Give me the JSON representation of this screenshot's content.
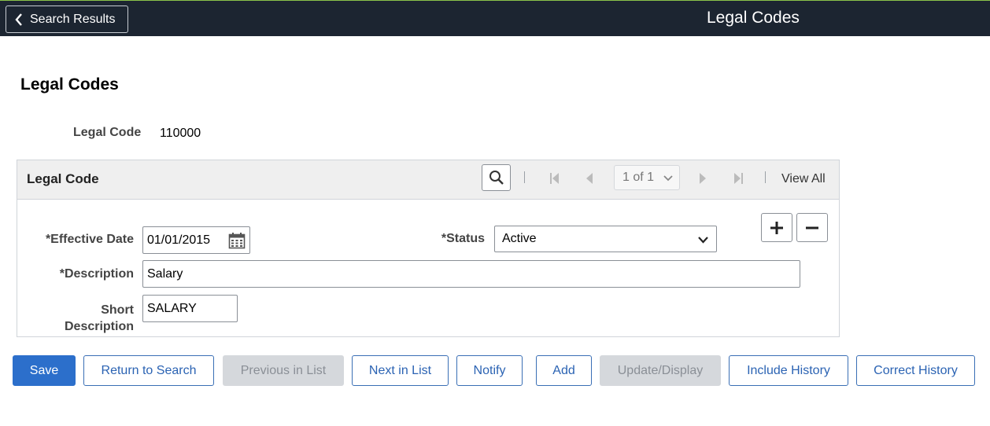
{
  "topbar": {
    "back_label": "Search Results",
    "app_title": "Legal Codes"
  },
  "page": {
    "title": "Legal Codes",
    "legal_code_label": "Legal Code",
    "legal_code_value": "110000"
  },
  "grid": {
    "title": "Legal Code",
    "page_indicator": "1 of 1",
    "view_all": "View All",
    "fields": {
      "effective_date_label": "*Effective Date",
      "effective_date_value": "01/01/2015",
      "status_label": "*Status",
      "status_value": "Active",
      "description_label": "*Description",
      "description_value": "Salary",
      "short_description_label_line1": "Short",
      "short_description_label_line2": "Description",
      "short_description_value": "SALARY"
    }
  },
  "buttons": {
    "save": "Save",
    "return_to_search": "Return to Search",
    "previous_in_list": "Previous in List",
    "next_in_list": "Next in List",
    "notify": "Notify",
    "add": "Add",
    "update_display": "Update/Display",
    "include_history": "Include History",
    "correct_history": "Correct History"
  },
  "icons": [
    "chevron-left-icon",
    "search-icon",
    "first-page-icon",
    "previous-page-icon",
    "chevron-down-icon",
    "next-page-icon",
    "last-page-icon",
    "calendar-icon",
    "plus-icon",
    "minus-icon"
  ],
  "colors": {
    "topbar_bg": "#1c2531",
    "primary": "#2c6fcb",
    "link": "#2b63b3",
    "disabled_bg": "#d5d8dc"
  }
}
